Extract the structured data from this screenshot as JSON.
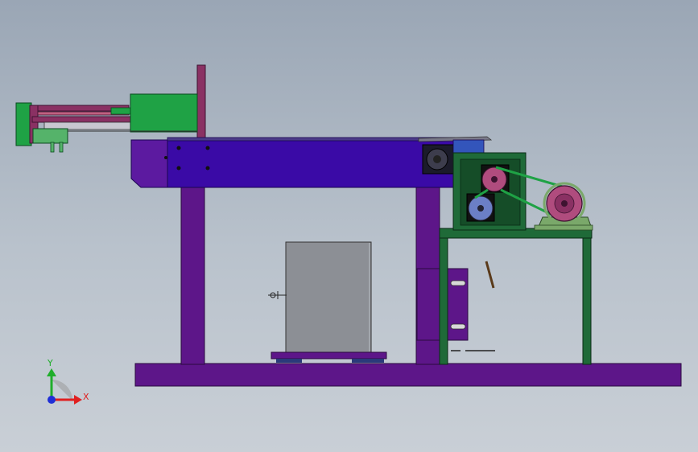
{
  "viewport": {
    "background_top": "#9aa6b5",
    "background_bottom": "#c9cfd6"
  },
  "colors": {
    "frame_purple": "#5d1689",
    "beam_blue": "#3a0aa6",
    "beam_violet": "#5c1aa0",
    "guard_green": "#1f6a38",
    "cylinder_green": "#1fa245",
    "rod_pink": "#8a3163",
    "panel_gray": "#8c8f95",
    "pulley_pink": "#b04c7e",
    "pulley_blue": "#6b7fc6",
    "motor_green": "#7aa86a"
  },
  "triad": {
    "x_label": "X",
    "y_label": "Y",
    "x_color": "#e02020",
    "y_color": "#1fae2b",
    "z_color": "#1f2fd6"
  }
}
